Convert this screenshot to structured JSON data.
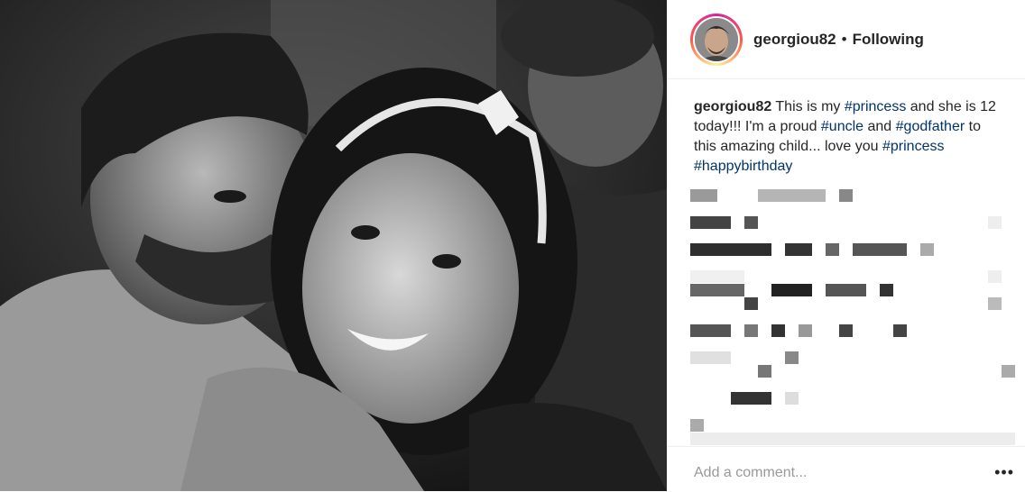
{
  "post": {
    "username": "georgiou82",
    "separator": "•",
    "follow_state": "Following"
  },
  "caption": {
    "username": "georgiou82",
    "t1": " This is my ",
    "tag1": "#princess",
    "t2": " and she is 12 today!!! I'm a proud ",
    "tag2": "#uncle",
    "t3": " and ",
    "tag3": "#godfather",
    "t4": " to this amazing child... love you ",
    "tag4": "#princess",
    "t5": " ",
    "tag5": "#happybirthday"
  },
  "comments_obscured": true,
  "comment_box": {
    "placeholder": "Add a comment...",
    "more_icon": "•••"
  },
  "colors": {
    "text": "#262626",
    "hashtag": "#003569",
    "placeholder": "#999999",
    "divider": "#efefef"
  }
}
